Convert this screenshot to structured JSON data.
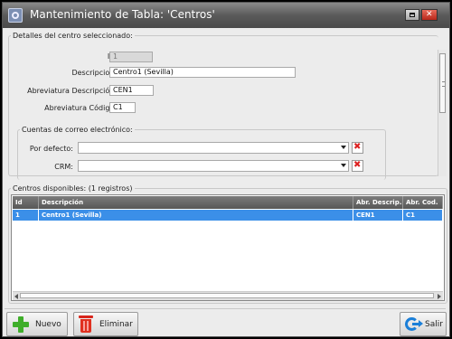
{
  "window": {
    "title": "Mantenimiento de Tabla: 'Centros'"
  },
  "details": {
    "legend": "Detalles del centro seleccionado:",
    "id": {
      "label": "Id:",
      "value": "1"
    },
    "descripcion": {
      "label": "Descripcion:",
      "value": "Centro1 (Sevilla)"
    },
    "abrev_descripcion": {
      "label": "Abreviatura Descripción:",
      "value": "CEN1"
    },
    "abrev_codigo": {
      "label": "Abreviatura Código:",
      "value": "C1"
    }
  },
  "email": {
    "legend": "Cuentas de correo electrónico:",
    "por_defecto": {
      "label": "Por defecto:",
      "value": ""
    },
    "crm": {
      "label": "CRM:",
      "value": ""
    }
  },
  "list": {
    "legend": "Centros disponibles:  (1 registros)",
    "columns": [
      "Id",
      "Descripción",
      "Abr. Descrip.",
      "Abr. Cod."
    ],
    "rows": [
      [
        "1",
        "Centro1 (Sevilla)",
        "CEN1",
        "C1"
      ]
    ]
  },
  "toolbar": {
    "nuevo_label": "Nuevo",
    "eliminar_label": "Eliminar",
    "salir_label": "Salir"
  },
  "icons": {
    "app": "app-icon",
    "restore": "restore-icon",
    "close": "close-icon",
    "clear": "delete-x-icon",
    "add": "plus-icon",
    "delete": "trash-icon",
    "exit": "exit-icon"
  },
  "colors": {
    "selection": "#3b8fe8",
    "header": "#575757",
    "add_icon": "#3fae2a",
    "delete_icon": "#e0301f",
    "exit_icon": "#1b7fd8"
  }
}
